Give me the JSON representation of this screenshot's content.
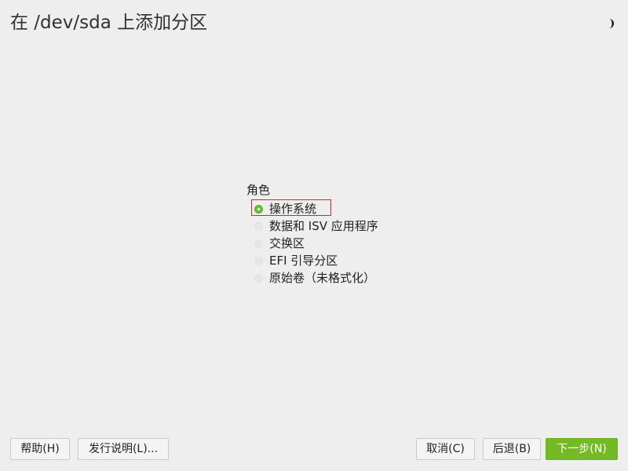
{
  "header": {
    "title": "在 /dev/sda 上添加分区",
    "theme_toggle_icon": "half-moon-icon"
  },
  "role": {
    "label": "角色",
    "options": [
      {
        "label": "操作系统",
        "selected": true
      },
      {
        "label": "数据和 ISV 应用程序",
        "selected": false
      },
      {
        "label": "交换区",
        "selected": false
      },
      {
        "label": "EFI 引导分区",
        "selected": false
      },
      {
        "label": "原始卷（未格式化）",
        "selected": false
      }
    ]
  },
  "buttons": {
    "help": "帮助(H)",
    "release_notes": "发行说明(L)...",
    "cancel": "取消(C)",
    "back": "后退(B)",
    "next": "下一步(N)"
  },
  "colors": {
    "accent": "#73ba25",
    "selection_outline": "#e0202a",
    "background": "#eeeeee"
  }
}
